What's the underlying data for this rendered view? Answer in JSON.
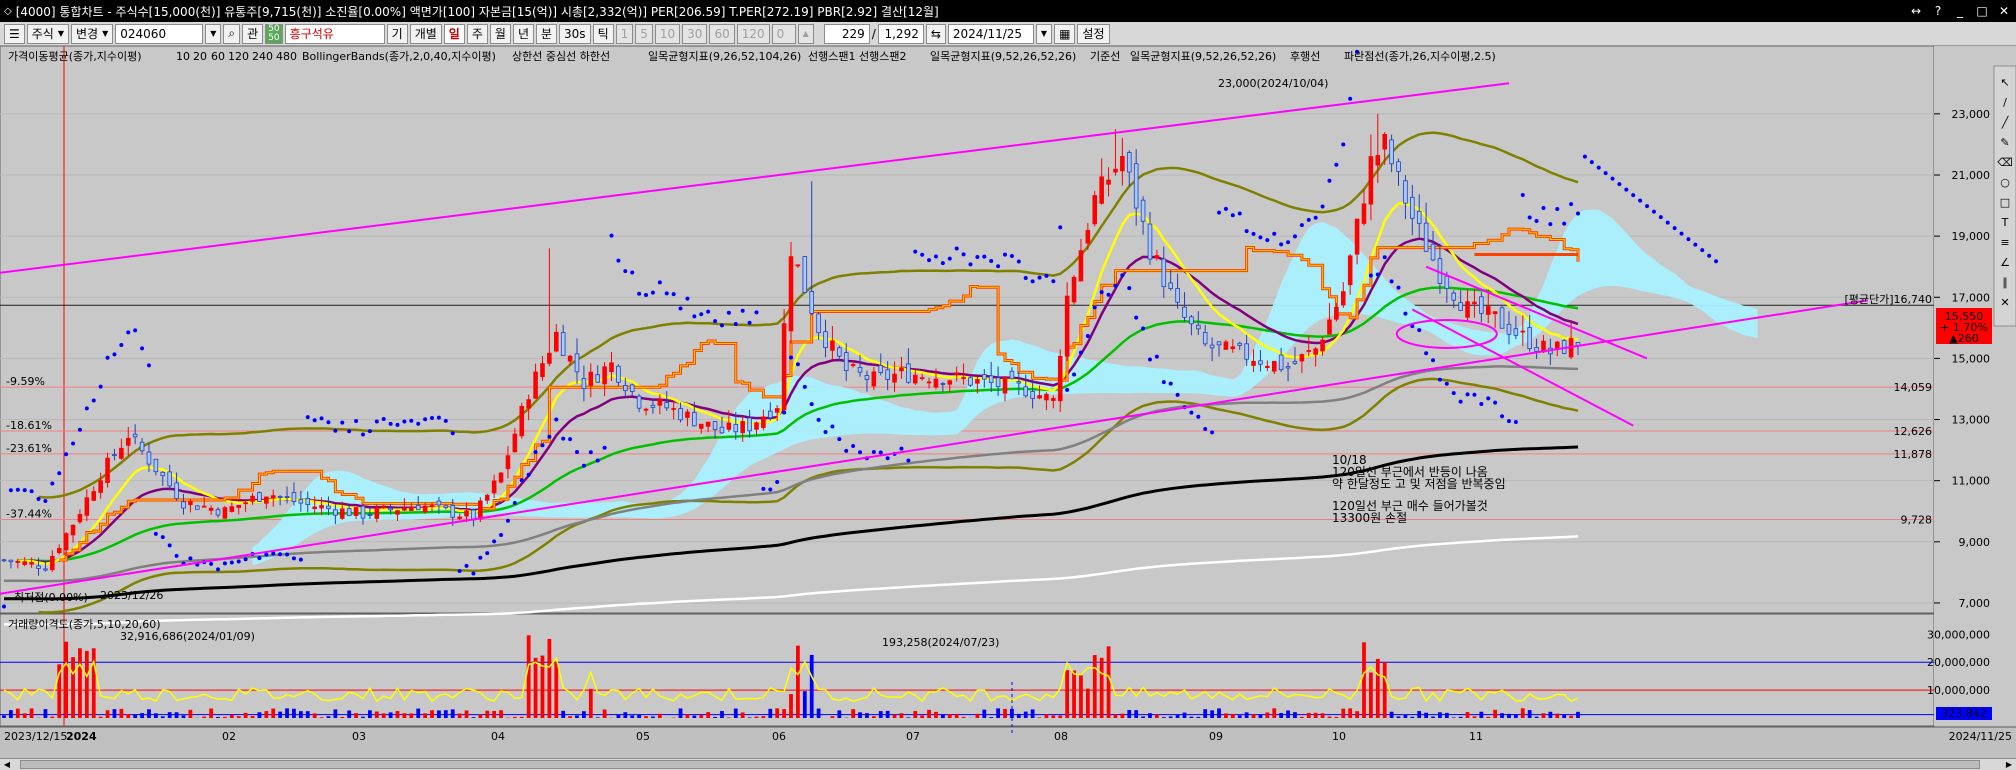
{
  "window": {
    "title": "[4000] 통합차트 - 주식수[15,000(천)] 유통주[9,715(천)] 소진율[0.00%] 액면가[100] 자본금[15(억)] 시총[2,332(억)] PER[206.59] T.PER[272.19] PBR[2.92] 결산[12월]",
    "buttons": [
      "↔",
      "?",
      "_",
      "□",
      "✕"
    ]
  },
  "toolbar": {
    "market": "주식",
    "change": "변경",
    "code": "024060",
    "search_icon": "magnifier-icon",
    "related": "관",
    "ratio_top": "50",
    "ratio_bottom": "50",
    "stock_name": "흥구석유",
    "periods": [
      "기",
      "개별",
      "일",
      "주",
      "월",
      "년",
      "분",
      "30s",
      "틱"
    ],
    "active_period": "일",
    "minute_steps": [
      "1",
      "5",
      "10",
      "30",
      "60",
      "120"
    ],
    "step_value": "0",
    "count": "229",
    "slash": "/",
    "total": "1,292",
    "date": "2024/11/25",
    "settings": "설정"
  },
  "legend": {
    "ma_name": "가격이동평균(종가,지수이평)",
    "ma_periods": [
      "10",
      "20",
      "60",
      "120",
      "240",
      "480"
    ],
    "bb_name": "BollingerBands(종가,2,0,40,지수이평)",
    "bb_lines": "상한선 중심선 하한선",
    "ichi1_name": "일목균형지표(9,26,52,104,26)",
    "ichi1_lines": "선행스팬1 선행스팬2",
    "ichi2_name": "일목균형지표(9,52,26,52,26)",
    "ichi2_lines": "기준선",
    "ichi3_name": "일목균형지표(9,52,26,52,26)",
    "ichi3_lines": "후행선",
    "psar_name": "파란점선(종가,26,지수이평,2.5)"
  },
  "price_axis": {
    "labels": [
      "23,000",
      "21,000",
      "19,000",
      "17,000",
      "15,000",
      "13,000",
      "11,000",
      "9,000",
      "7,000"
    ],
    "avg_label": "[평균단가]16,740",
    "current_price": "15,550",
    "change_pct": "+ 1.70%",
    "change_amt": "▲260",
    "level_14059": "14,059",
    "level_12626": "12,626",
    "level_11878": "11,878",
    "level_9728": "9,728"
  },
  "retracements": [
    "-9.59%",
    "-18.61%",
    "-23.61%",
    "-37.44%"
  ],
  "annotations": {
    "high": "23,000(2024/10/04)",
    "low_label": "최저점(0.00%)",
    "low_date": "2023/12/26",
    "note_date": "10/18",
    "note_line1": "120일선 부근에서 반등이 나옴",
    "note_line2": "약 한달정도 고 및 저점을 반복중임",
    "note_line3": "120일선 부근 매수 들어가볼것",
    "note_line4": "13300원 손절"
  },
  "volume": {
    "legend": "거래량이격도(종가,5,10,20,60)",
    "max_label": "32,916,686(2024/01/09)",
    "mid_label": "193,258(2024/07/23)",
    "axis": [
      "30,000,000",
      "20,000,000",
      "10,000,000"
    ],
    "last": "323,842"
  },
  "date_axis": {
    "start": "2023/12/15",
    "year": "2024",
    "months": [
      "02",
      "03",
      "04",
      "05",
      "06",
      "07",
      "08",
      "09",
      "10",
      "11"
    ],
    "end": "2024/11/25"
  },
  "colors": {
    "up": "#ff0000",
    "down": "#0000ff",
    "ma10": "#ffff00",
    "ma20": "#800080",
    "ma60": "#00c000",
    "ma120": "#808080",
    "ma240": "#000000",
    "ma480": "#ffffff",
    "bollinger": "#808000",
    "cloud": "#aaf0ff",
    "trendline": "#ff00ff",
    "kijun": "#ff8000",
    "psar": "#0000ff"
  },
  "tools": [
    "cursor-icon",
    "line-icon",
    "ray-icon",
    "pen-icon",
    "eraser-icon",
    "circle-icon",
    "rectangle-icon",
    "text-icon",
    "fibo-icon",
    "gann-icon",
    "channel-icon",
    "delete-icon"
  ]
}
